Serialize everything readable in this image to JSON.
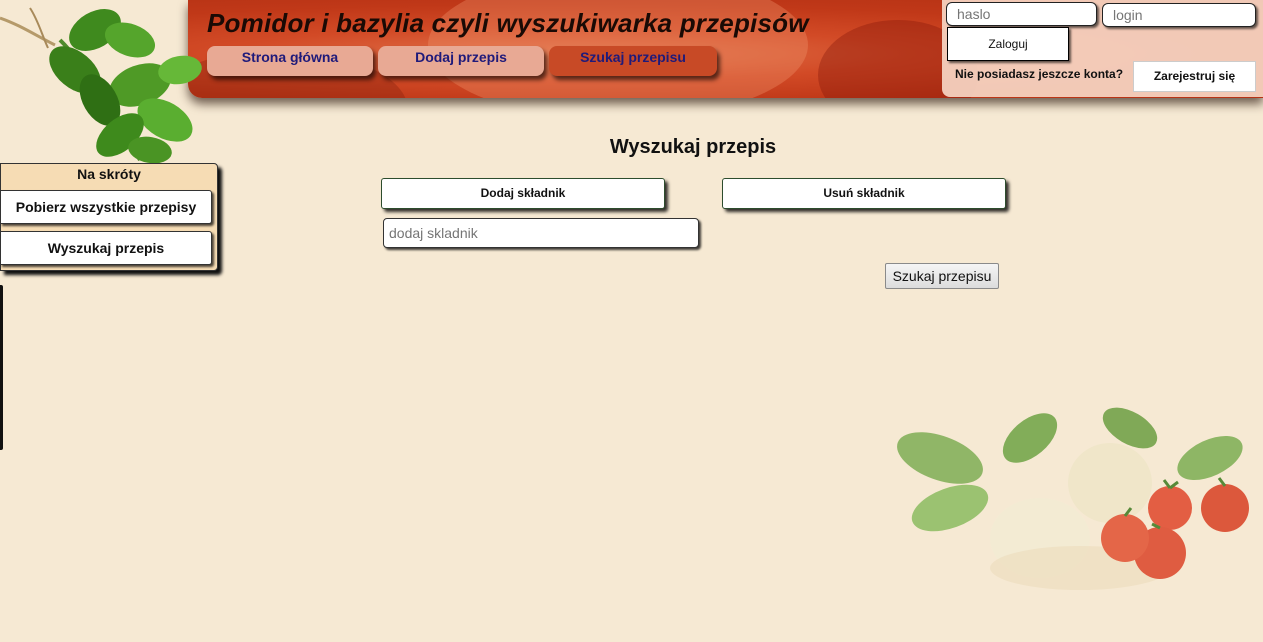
{
  "header": {
    "title": "Pomidor i bazylia czyli wyszukiwarka przepisów",
    "nav": [
      {
        "label": "Strona główna"
      },
      {
        "label": "Dodaj przepis"
      },
      {
        "label": "Szukaj przepisu"
      }
    ]
  },
  "login": {
    "password_placeholder": "haslo",
    "login_placeholder": "login",
    "login_button": "Zaloguj",
    "no_account_text": "Nie posiadasz jeszcze konta?",
    "register_button": "Zarejestruj się"
  },
  "sidebar": {
    "heading": "Na skróty",
    "items": [
      {
        "label": "Pobierz wszystkie przepisy"
      },
      {
        "label": "Wyszukaj przepis"
      }
    ]
  },
  "main": {
    "title": "Wyszukaj przepis",
    "add_ingredient_button": "Dodaj składnik",
    "remove_ingredient_button": "Usuń składnik",
    "ingredient_placeholder": "dodaj skladnik",
    "search_button": "Szukaj przepisu"
  },
  "colors": {
    "background": "#f6e9d3",
    "header_red": "#c03818",
    "nav_text": "#1f1a7a"
  },
  "icons": [
    "basil-logo-icon",
    "food-decoration-icon"
  ]
}
